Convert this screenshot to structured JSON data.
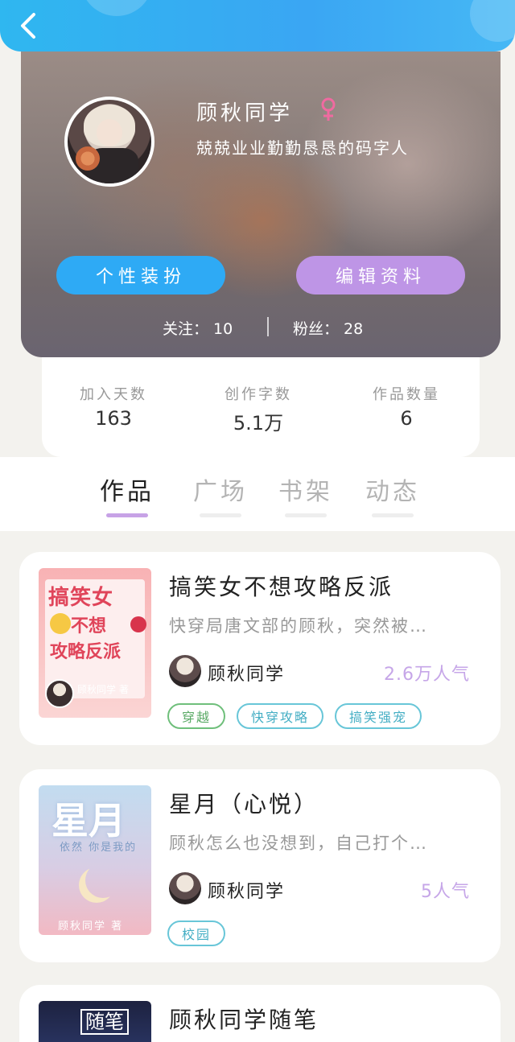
{
  "profile": {
    "username": "顾秋同学",
    "bio": "兢兢业业勤勤恳恳的码字人",
    "dress_button": "个性装扮",
    "edit_button": "编辑资料",
    "follow_text": "关注： 10",
    "fans_text": "粉丝： 28"
  },
  "stats": [
    {
      "label": "加入天数",
      "value": "163"
    },
    {
      "label": "创作字数",
      "value": "5.1万"
    },
    {
      "label": "作品数量",
      "value": "6"
    }
  ],
  "tabs": [
    {
      "label": "作品",
      "active": true
    },
    {
      "label": "广场",
      "active": false
    },
    {
      "label": "书架",
      "active": false
    },
    {
      "label": "动态",
      "active": false
    }
  ],
  "works": [
    {
      "title": "搞笑女不想攻略反派",
      "desc": "快穿局唐文部的顾秋，突然被…",
      "author": "顾秋同学",
      "popularity": "2.6万人气",
      "cover": {
        "line1": "搞笑女",
        "line2": "不想",
        "line3": "攻略反派",
        "author": "顾秋同学 著"
      },
      "tags": [
        "穿越",
        "快穿攻略",
        "搞笑强宠"
      ]
    },
    {
      "title": "星月（心悦）",
      "desc": "顾秋怎么也没想到，自己打个…",
      "author": "顾秋同学",
      "popularity": "5人气",
      "cover": {
        "line1": "星月",
        "line2": "依然 你是我的",
        "author": "顾秋同学 著"
      },
      "tags": [
        "校园"
      ]
    },
    {
      "title": "顾秋同学随笔",
      "cover": {
        "line1": "随笔"
      }
    }
  ],
  "colors": {
    "topbar": "#2fb7f0",
    "dress_button": "#2eaaf5",
    "edit_button": "#be95e6",
    "popularity": "#c6a6e8",
    "active_tab_bar": "#c7a2e6",
    "gender": "#f06aa0"
  },
  "icons": {
    "back": "back-arrow-icon",
    "gender": "female-icon"
  }
}
